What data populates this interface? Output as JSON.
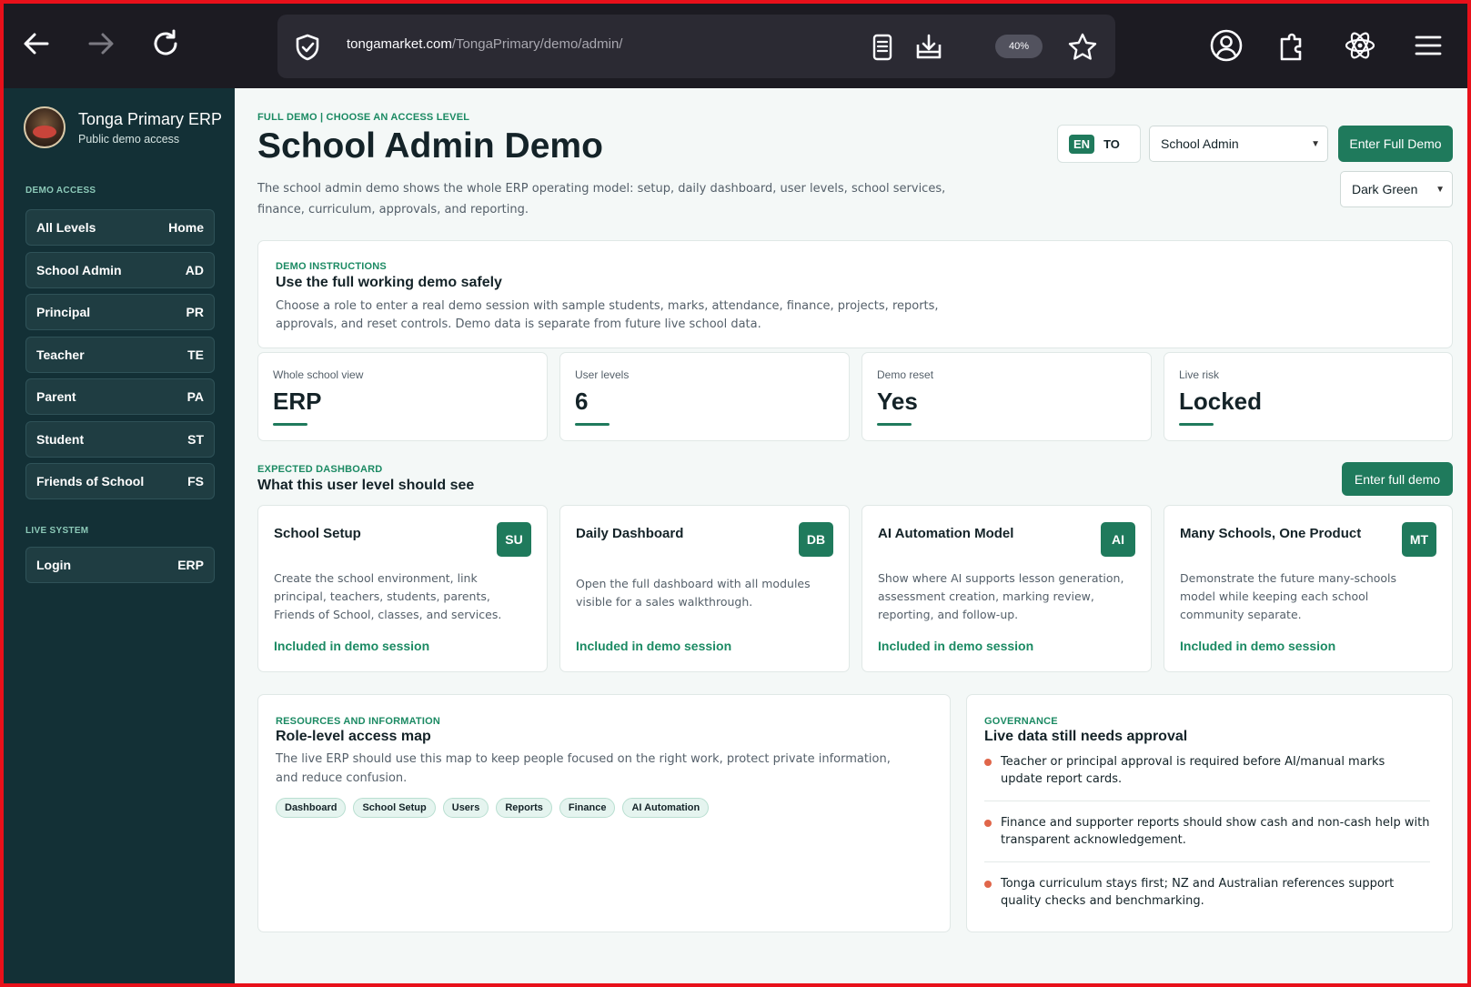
{
  "browser": {
    "url_host": "tongamarket.com",
    "url_path": "/TongaPrimary/demo/admin/",
    "zoom": "40%"
  },
  "sidebar": {
    "brand_title": "Tonga Primary ERP",
    "brand_subtitle": "Public demo access",
    "demo_section_label": "DEMO ACCESS",
    "items": [
      {
        "label": "All Levels",
        "code": "Home"
      },
      {
        "label": "School Admin",
        "code": "AD"
      },
      {
        "label": "Principal",
        "code": "PR"
      },
      {
        "label": "Teacher",
        "code": "TE"
      },
      {
        "label": "Parent",
        "code": "PA"
      },
      {
        "label": "Student",
        "code": "ST"
      },
      {
        "label": "Friends of School",
        "code": "FS"
      }
    ],
    "live_section_label": "LIVE SYSTEM",
    "live_items": [
      {
        "label": "Login",
        "code": "ERP"
      }
    ]
  },
  "header": {
    "eyebrow": "FULL DEMO | CHOOSE AN ACCESS LEVEL",
    "title": "School Admin Demo",
    "description": "The school admin demo shows the whole ERP operating model: setup, daily dashboard, user levels, school services, finance, curriculum, approvals, and reporting.",
    "lang_en": "EN",
    "lang_to": "TO",
    "role_select": "School Admin",
    "enter_button": "Enter Full Demo",
    "theme_select": "Dark Green"
  },
  "instructions": {
    "eyebrow": "DEMO INSTRUCTIONS",
    "title": "Use the full working demo safely",
    "text": "Choose a role to enter a real demo session with sample students, marks, attendance, finance, projects, reports, approvals, and reset controls. Demo data is separate from future live school data."
  },
  "stats": [
    {
      "label": "Whole school view",
      "value": "ERP"
    },
    {
      "label": "User levels",
      "value": "6"
    },
    {
      "label": "Demo reset",
      "value": "Yes"
    },
    {
      "label": "Live risk",
      "value": "Locked"
    }
  ],
  "dashboard": {
    "eyebrow": "EXPECTED DASHBOARD",
    "title": "What this user level should see",
    "enter_button": "Enter full demo",
    "modules": [
      {
        "title": "School Setup",
        "badge": "SU",
        "desc": "Create the school environment, link principal, teachers, students, parents, Friends of School, classes, and services.",
        "foot": "Included in demo session"
      },
      {
        "title": "Daily Dashboard",
        "badge": "DB",
        "desc": "Open the full dashboard with all modules visible for a sales walkthrough.",
        "foot": "Included in demo session"
      },
      {
        "title": "AI Automation Model",
        "badge": "AI",
        "desc": "Show where AI supports lesson generation, assessment creation, marking review, reporting, and follow-up.",
        "foot": "Included in demo session"
      },
      {
        "title": "Many Schools, One Product",
        "badge": "MT",
        "desc": "Demonstrate the future many-schools model while keeping each school community separate.",
        "foot": "Included in demo session"
      }
    ]
  },
  "resources": {
    "eyebrow": "RESOURCES AND INFORMATION",
    "title": "Role-level access map",
    "text": "The live ERP should use this map to keep people focused on the right work, protect private information, and reduce confusion.",
    "chips": [
      "Dashboard",
      "School Setup",
      "Users",
      "Reports",
      "Finance",
      "AI Automation"
    ]
  },
  "governance": {
    "eyebrow": "GOVERNANCE",
    "title": "Live data still needs approval",
    "items": [
      "Teacher or principal approval is required before AI/manual marks update report cards.",
      "Finance and supporter reports should show cash and non-cash help with transparent acknowledgement.",
      "Tonga curriculum stays first; NZ and Australian references support quality checks and benchmarking."
    ]
  },
  "colors": {
    "sidebar_bg": "#133036",
    "accent_green": "#1f7a5c",
    "bullet_orange": "#e0664a",
    "frame_red": "#e8101a"
  }
}
